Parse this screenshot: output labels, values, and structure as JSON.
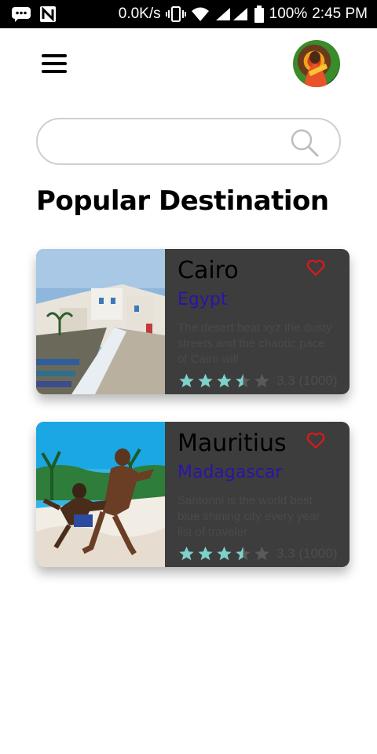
{
  "status_bar": {
    "speed": "0.0K/s",
    "battery": "100%",
    "time": "2:45 PM"
  },
  "search": {
    "placeholder": "",
    "value": ""
  },
  "section_title": "Popular Destination",
  "colors": {
    "card_bg": "#3d3d3d",
    "subtitle": "#2d13a8",
    "star": "#7fd1cb",
    "heart": "#e01818"
  },
  "cards": [
    {
      "title": "Cairo",
      "subtitle": "Egypt",
      "description": "The desert heat xyz the dusty streets and the chaotic pace of Cairo will",
      "rating": 3.5,
      "rating_text": "3.3 (1000)",
      "image": "coastal-town-photo"
    },
    {
      "title": "Mauritius",
      "subtitle": "Madagascar",
      "description": "Santorini is the world best blue shining city every year list of traveler",
      "rating": 3.5,
      "rating_text": "3.3 (1000)",
      "image": "kids-on-beach-photo"
    }
  ]
}
